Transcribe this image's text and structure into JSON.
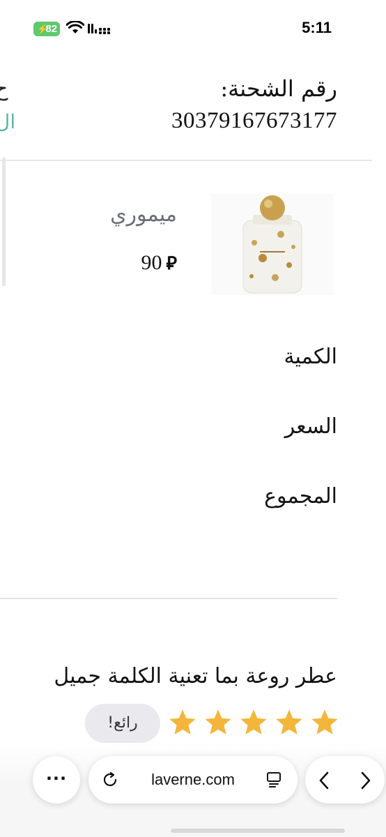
{
  "status_bar": {
    "time": "5:11",
    "battery": "82"
  },
  "shipment": {
    "label": "رقم الشحنة:",
    "number": "30379167673177",
    "cut_text_1": "ح",
    "cut_text_2": "ال"
  },
  "product": {
    "name": "ميموري",
    "price": "90",
    "currency_symbol": "⃁"
  },
  "order_info": {
    "quantity_label": "الكمية",
    "price_label": "السعر",
    "total_label": "المجموع"
  },
  "review": {
    "text": "عطر روعة بما تعنية الكلمة جميل",
    "rating": 5,
    "rating_max": 5,
    "badge": "رائع!",
    "star_color": "#f4b63a"
  },
  "browser": {
    "url": "laverne.com",
    "more_label": "···"
  }
}
